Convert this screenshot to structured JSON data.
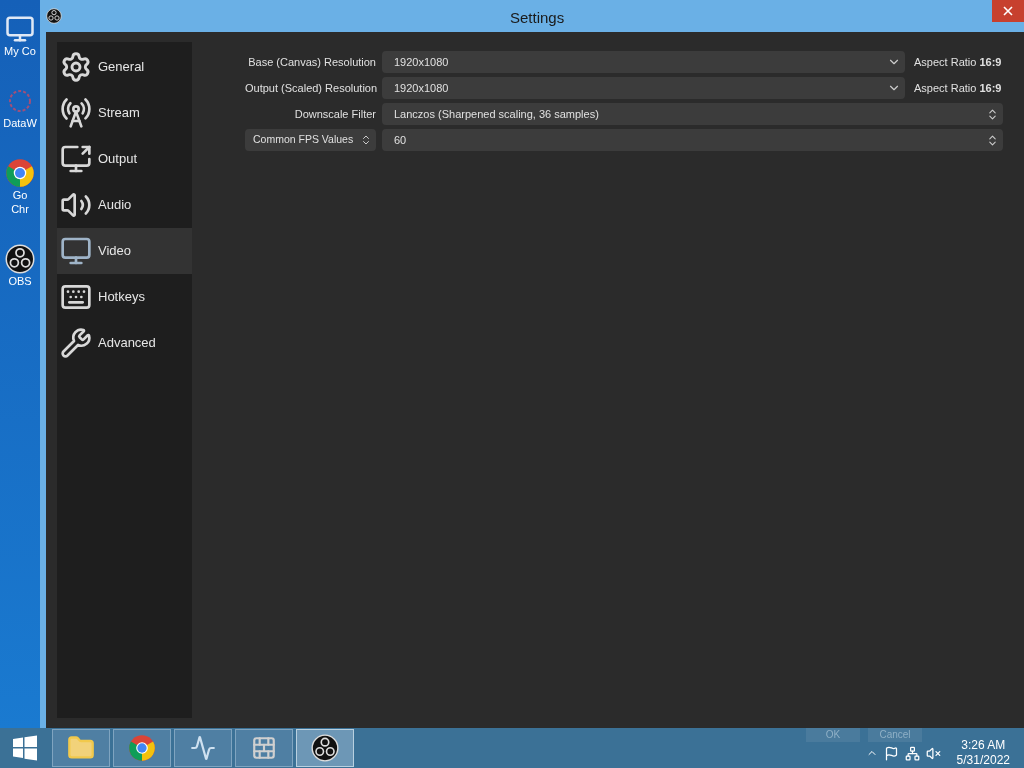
{
  "desktop_icons": [
    {
      "kind": "computer",
      "lines": [
        "My Co"
      ]
    },
    {
      "kind": "data",
      "lines": [
        "DataW"
      ]
    },
    {
      "kind": "chrome",
      "lines": [
        "Go",
        "Chr"
      ]
    },
    {
      "kind": "obs",
      "lines": [
        "OBS"
      ]
    }
  ],
  "window": {
    "title": "Settings"
  },
  "sidebar": {
    "items": [
      {
        "kind": "general",
        "label": "General",
        "selected": false
      },
      {
        "kind": "stream",
        "label": "Stream",
        "selected": false
      },
      {
        "kind": "output",
        "label": "Output",
        "selected": false
      },
      {
        "kind": "audio",
        "label": "Audio",
        "selected": false
      },
      {
        "kind": "video",
        "label": "Video",
        "selected": true
      },
      {
        "kind": "hotkeys",
        "label": "Hotkeys",
        "selected": false
      },
      {
        "kind": "advanced",
        "label": "Advanced",
        "selected": false
      }
    ]
  },
  "video_settings": [
    {
      "kind": "dropdown",
      "label": "Base (Canvas) Resolution",
      "value": "1920x1080",
      "note": "Aspect Ratio **16:9**"
    },
    {
      "kind": "dropdown",
      "label": "Output (Scaled) Resolution",
      "value": "1920x1080",
      "note": "Aspect Ratio **16:9**"
    },
    {
      "kind": "spin",
      "label": "Downscale Filter",
      "value": "Lanczos (Sharpened scaling, 36 samples)"
    },
    {
      "kind": "spin-selector",
      "label": "Common FPS Values",
      "value": "60"
    }
  ],
  "dialog_buttons": [
    {
      "label": "OK"
    },
    {
      "label": "Cancel"
    }
  ],
  "taskbar": {
    "apps": [
      {
        "kind": "explorer",
        "selected": false
      },
      {
        "kind": "chrome",
        "selected": false
      },
      {
        "kind": "monitor",
        "selected": false
      },
      {
        "kind": "firewall",
        "selected": false
      },
      {
        "kind": "obs",
        "selected": true
      }
    ],
    "time": "3:26 AM",
    "date": "5/31/2022"
  }
}
